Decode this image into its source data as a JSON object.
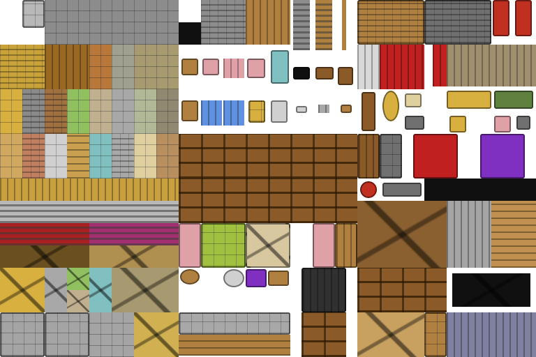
{
  "tileset": {
    "kind": "rpg-interior-tileset",
    "background": "#ffffff",
    "colors": {
      "grate": "#b8b8b8",
      "stone": "#8c8c8c",
      "yellow_brick": "#c9a23a",
      "wood_log": "#9a6a24",
      "orange_cobble": "#b8783a",
      "gray_cobble": "#a0a090",
      "beige_stone": "#a89a70",
      "yellow_tile": "#d8b040",
      "gray_brick": "#8a8a8a",
      "brown_brick": "#a07040",
      "green_tile": "#90c060",
      "sand_stone": "#c0b090",
      "light_gray": "#a8a8a8",
      "sage": "#b0b898",
      "dark_stone": "#908870",
      "tan": "#d0a860",
      "red_brick": "#c08060",
      "white_stone": "#d0d0d0",
      "herringbone": "#c8a050",
      "teal": "#80c0c0",
      "cream": "#e0d0a0",
      "light_brown": "#b89060",
      "wood_floor": "#c8a040",
      "silver_stripe": "#b8b8b8",
      "red_carpet": "#a82020",
      "magenta_carpet": "#a03070",
      "cracked_dark": "#6a5020",
      "cracked_tan": "#b09050",
      "carved_gray": "#a4a4a4",
      "carved_gold": "#d0b050",
      "wood": "#8a5a28",
      "light_wood": "#b08040",
      "pink": "#e0a0a8",
      "lime": "#a0c040",
      "linen": "#d8c8a0",
      "black": "#101010",
      "piano": "#303030",
      "banner": "#c03020",
      "curtain_white": "#d8d8d8",
      "curtain_red": "#c02020",
      "curtain_tan": "#a09070",
      "throne_red": "#c02020",
      "throne_purple": "#8030c0",
      "gold": "#d8b040",
      "iron": "#707070",
      "window_blue": "#6090e0",
      "fence": "#8080a0",
      "sack": "#c8a060",
      "pottery": "#8a6030",
      "barrel": "#c09050",
      "painting": "#608040",
      "book_red": "#b02020",
      "book_blue": "#3050a0"
    }
  }
}
